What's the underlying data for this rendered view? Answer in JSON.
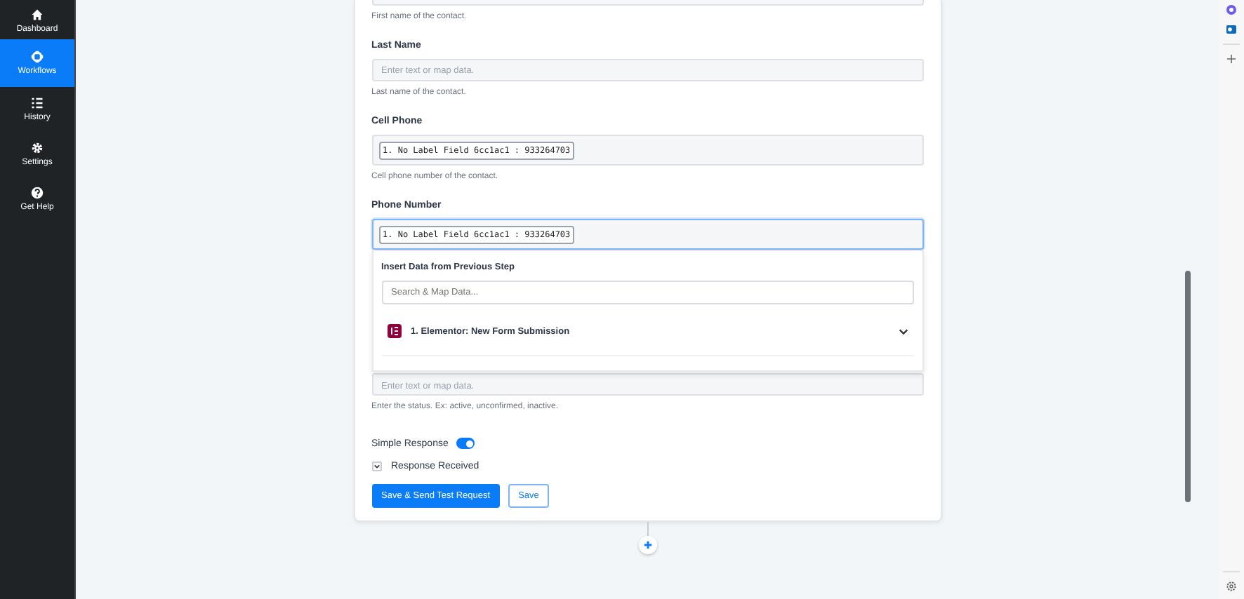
{
  "sidebar": {
    "items": [
      {
        "label": "Dashboard",
        "selected": false
      },
      {
        "label": "Workflows",
        "selected": true
      },
      {
        "label": "History",
        "selected": false
      },
      {
        "label": "Settings",
        "selected": false
      },
      {
        "label": "Get Help",
        "selected": false
      }
    ]
  },
  "form": {
    "fields": [
      {
        "kind": "partial",
        "hint": "First name of the contact."
      },
      {
        "kind": "text",
        "label": "Last Name",
        "placeholder": "Enter text or map data.",
        "hint": "Last name of the contact."
      },
      {
        "kind": "chip",
        "label": "Cell Phone",
        "chip": "1. No Label Field 6cc1ac1 : 933264703",
        "hint": "Cell phone number of the contact.",
        "focused": false
      },
      {
        "kind": "chip",
        "label": "Phone Number",
        "chip": "1. No Label Field 6cc1ac1 : 933264703",
        "focused": true,
        "dropdown": {
          "title": "Insert Data from Previous Step",
          "search_placeholder": "Search & Map Data...",
          "steps": [
            {
              "label": "1. Elementor: New Form Submission",
              "expanded": false
            }
          ]
        }
      },
      {
        "kind": "covered",
        "placeholder": "Enter text or map data.",
        "hint": "Enter the status. Ex: active, unconfirmed, inactive."
      }
    ],
    "simple_response": {
      "label": "Simple Response",
      "on": true
    },
    "response_received": {
      "label": "Response Received",
      "expanded": false
    },
    "buttons": [
      {
        "label": "Save & Send Test Request",
        "kind": "primary"
      },
      {
        "label": "Save",
        "kind": "secondary"
      }
    ]
  }
}
